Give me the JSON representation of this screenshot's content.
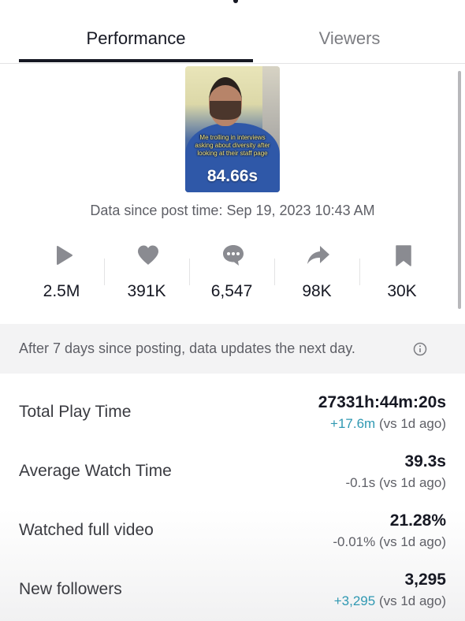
{
  "tabs": [
    {
      "label": "Performance",
      "selected": true
    },
    {
      "label": "Viewers",
      "selected": false
    }
  ],
  "video": {
    "caption": "Me trolling in interviews asking about diversity after looking at their staff page",
    "duration": "84.66s"
  },
  "posted_at": "Data since post time: Sep 19, 2023 10:43 AM",
  "stats": [
    {
      "icon": "play-icon",
      "value": "2.5M"
    },
    {
      "icon": "heart-icon",
      "value": "391K"
    },
    {
      "icon": "comment-icon",
      "value": "6,547"
    },
    {
      "icon": "share-icon",
      "value": "98K"
    },
    {
      "icon": "bookmark-icon",
      "value": "30K"
    }
  ],
  "notice": "After 7 days since posting, data updates the next day.",
  "metrics": [
    {
      "label": "Total Play Time",
      "value": "27331h:44m:20s",
      "delta": "+17.6m",
      "comparison": " (vs 1d ago)",
      "delta_color": "#2f98b2"
    },
    {
      "label": "Average Watch Time",
      "value": "39.3s",
      "delta": "-0.1s",
      "comparison": " (vs 1d ago)",
      "delta_color": "#5e5f66"
    },
    {
      "label": "Watched full video",
      "value": "21.28%",
      "delta": "-0.01%",
      "comparison": " (vs 1d ago)",
      "delta_color": "#5e5f66"
    },
    {
      "label": "New followers",
      "value": "3,295",
      "delta": "+3,295",
      "comparison": " (vs 1d ago)",
      "delta_color": "#2f98b2"
    }
  ],
  "colors": {
    "text_primary": "#161823",
    "text_secondary": "#5e5f66",
    "icon_gray": "#8a8b91",
    "positive_delta": "#2f98b2",
    "notice_background": "#f3f3f4"
  }
}
